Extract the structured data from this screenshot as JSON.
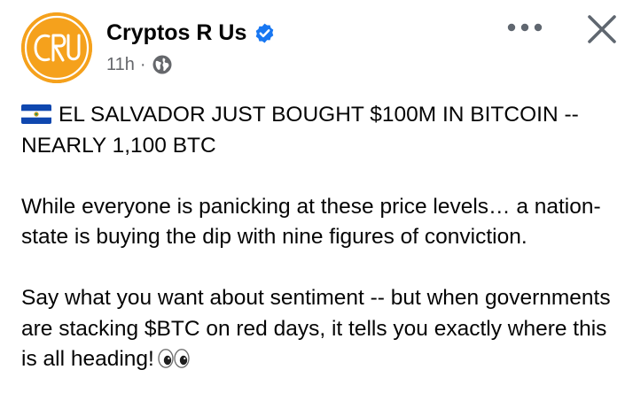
{
  "post": {
    "author_name": "Cryptos R Us",
    "timestamp": "11h",
    "separator": "·",
    "avatar_text": "CRU",
    "verified_icon": "verified-badge-icon",
    "audience_icon": "globe-icon",
    "headline": "EL SALVADOR JUST BOUGHT $100M IN BITCOIN -- NEARLY 1,100 BTC",
    "paragraph_1": "While everyone is panicking at these price levels… a nation-state is buying the dip with nine figures of conviction.",
    "paragraph_2": "Say what you want about sentiment -- but when governments are stacking $BTC on red days, it tells you exactly where this is all heading!",
    "flag_icon": "el-salvador-flag-icon",
    "eyes_icon": "eyes-emoji-icon"
  },
  "actions": {
    "more_icon": "more-options-icon",
    "close_icon": "close-icon"
  },
  "colors": {
    "avatar_bg": "#f5a11c",
    "verified_blue": "#1877f2",
    "meta_gray": "#65676b",
    "text": "#050505",
    "icon_gray": "#606770"
  }
}
